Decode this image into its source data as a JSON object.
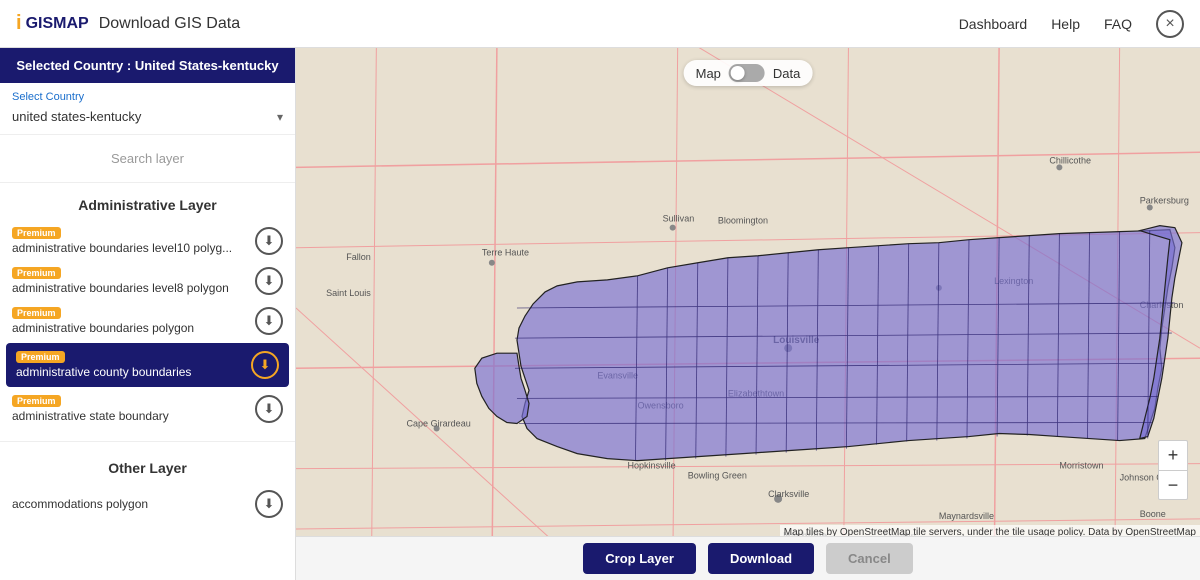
{
  "header": {
    "logo_icon": "i",
    "logo_text": "GISMAP",
    "title": "Download GIS Data",
    "nav": [
      "Dashboard",
      "Help",
      "FAQ"
    ],
    "close_label": "×"
  },
  "sidebar": {
    "selected_country_banner": "Selected Country : United States-kentucky",
    "select_country_label": "Select Country",
    "selected_country_value": "united states-kentucky",
    "search_layer_placeholder": "Search layer",
    "administrative_layer_title": "Administrative Layer",
    "layers": [
      {
        "id": "l1",
        "premium": true,
        "name": "administrative boundaries level10 polyg...",
        "active": false
      },
      {
        "id": "l2",
        "premium": true,
        "name": "administrative boundaries level8 polygon",
        "active": false
      },
      {
        "id": "l3",
        "premium": true,
        "name": "administrative boundaries polygon",
        "active": false
      },
      {
        "id": "l4",
        "premium": true,
        "name": "administrative county boundaries",
        "active": true
      },
      {
        "id": "l5",
        "premium": true,
        "name": "administrative state boundary",
        "active": false
      }
    ],
    "other_layer_title": "Other Layer",
    "other_layers": [
      {
        "id": "o1",
        "premium": false,
        "name": "accommodations polygon",
        "active": false
      }
    ],
    "premium_label": "Premium"
  },
  "map": {
    "toggle_map_label": "Map",
    "toggle_data_label": "Data",
    "attribution": "Map tiles by OpenStreetMap tile servers, under the tile usage policy. Data by OpenStreetMap",
    "zoom_in": "+",
    "zoom_out": "−"
  },
  "bottom_bar": {
    "crop_layer_label": "Crop Layer",
    "download_label": "Download",
    "cancel_label": "Cancel"
  },
  "colors": {
    "navy": "#1a1a6e",
    "gold": "#f5a623",
    "kentucky_fill": "rgba(120, 110, 210, 0.65)",
    "kentucky_stroke": "#222"
  }
}
